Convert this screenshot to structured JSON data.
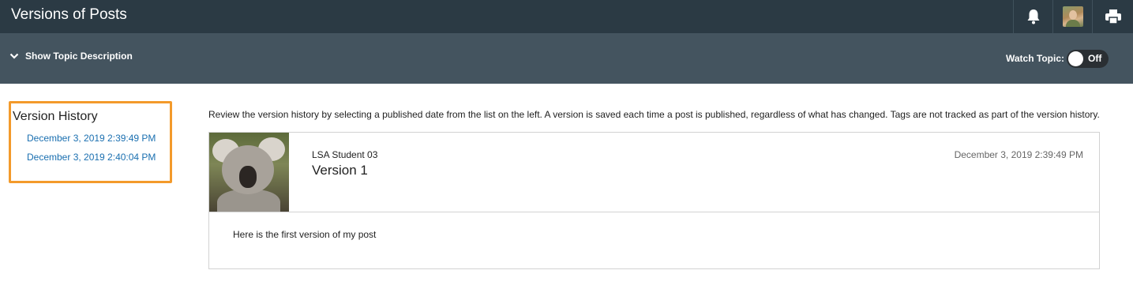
{
  "header": {
    "title": "Versions of Posts",
    "icons": [
      "bell-icon",
      "user-avatar",
      "print-icon"
    ]
  },
  "subbar": {
    "show_description_label": "Show Topic Description",
    "watch_topic_label": "Watch Topic:",
    "watch_toggle_state": "Off"
  },
  "version_history": {
    "title": "Version History",
    "versions": [
      "December 3, 2019 2:39:49 PM",
      "December 3, 2019 2:40:04 PM"
    ]
  },
  "main": {
    "intro": "Review the version history by selecting a published date from the list on the left. A version is saved each time a post is published, regardless of what has changed. Tags are not tracked as part of the version history.",
    "post": {
      "author": "LSA Student 03",
      "title": "Version 1",
      "date": "December 3, 2019 2:39:49 PM",
      "body": "Here is the first version of my post"
    }
  },
  "colors": {
    "topbar": "#2b3a44",
    "subbar": "#44545f",
    "highlight": "#f39a2b",
    "link": "#1a6fb0"
  }
}
